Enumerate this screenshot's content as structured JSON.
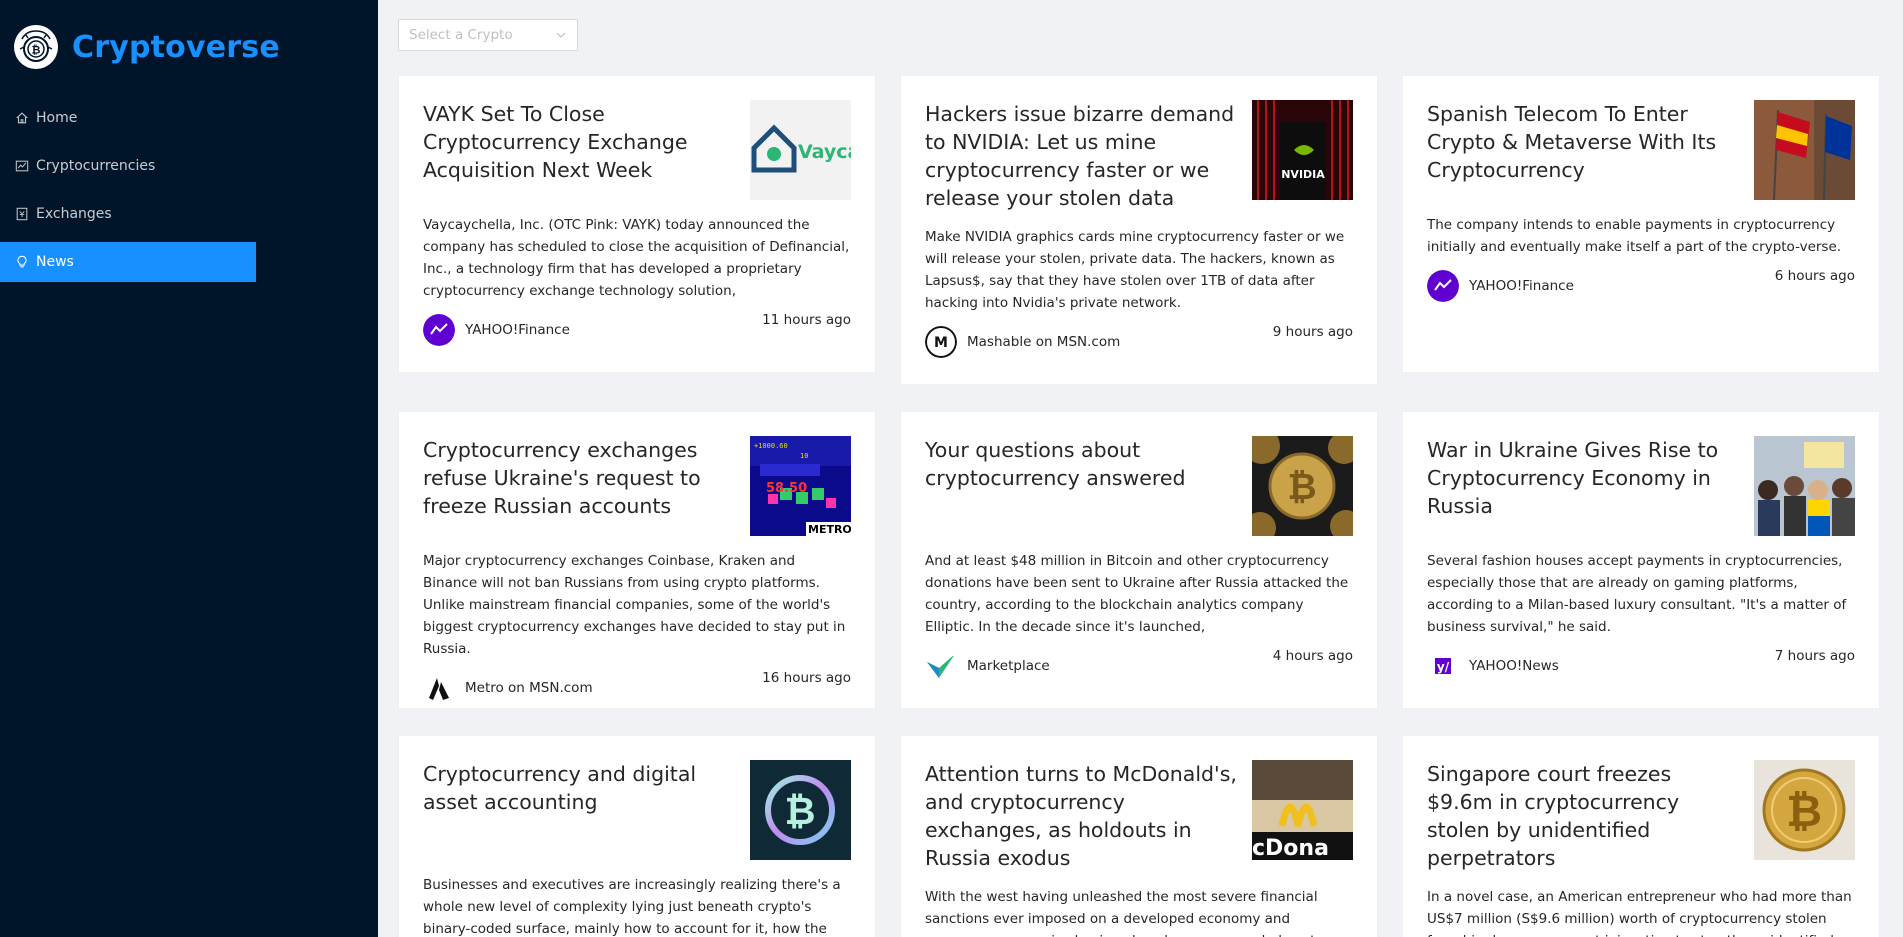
{
  "app": {
    "title": "Cryptoverse",
    "brand_color": "#1890ff",
    "sidebar_bg": "#001529"
  },
  "menu": [
    {
      "label": "Home",
      "icon": "home-icon"
    },
    {
      "label": "Cryptocurrencies",
      "icon": "fund-icon"
    },
    {
      "label": "Exchanges",
      "icon": "money-collect-icon"
    },
    {
      "label": "News",
      "icon": "bulb-icon",
      "active": true
    }
  ],
  "select": {
    "placeholder": "Select a Crypto"
  },
  "news": [
    {
      "title": "VAYK Set To Close Cryptocurrency Exchange Acquisition Next Week",
      "description": "Vaycaychella, Inc. (OTC Pink: VAYK) today announced the company has scheduled to close the acquisition of Definancial, Inc., a technology firm that has developed a proprietary cryptocurrency exchange technology solution,",
      "provider": "YAHOO!Finance",
      "time": "11 hours ago",
      "thumb_text": "Vayca"
    },
    {
      "title": "Hackers issue bizarre demand to NVIDIA: Let us mine cryptocurrency faster or we release your stolen data",
      "description": "Make NVIDIA graphics cards mine cryptocurrency faster or we will release your stolen, private data. The hackers, known as Lapsus$, say that they have stolen over 1TB of data after hacking into Nvidia's private network.",
      "provider": "Mashable on MSN.com",
      "time": "9 hours ago",
      "thumb_text": "NVIDIA"
    },
    {
      "title": "Spanish Telecom To Enter Crypto & Metaverse With Its Cryptocurrency",
      "description": "The company intends to enable payments in cryptocurrency initially and eventually make itself a part of the crypto-verse.",
      "provider": "YAHOO!Finance",
      "time": "6 hours ago"
    },
    {
      "title": "Cryptocurrency exchanges refuse Ukraine's request to freeze Russian accounts",
      "description": "Major cryptocurrency exchanges Coinbase, Kraken and Binance will not ban Russians from using crypto platforms. Unlike mainstream financial companies, some of the world's biggest cryptocurrency exchanges have decided to stay put in Russia.",
      "provider": "Metro on MSN.com",
      "time": "16 hours ago",
      "thumb_text": "METRO.c"
    },
    {
      "title": "Your questions about cryptocurrency answered",
      "description": "And at least $48 million in Bitcoin and other cryptocurrency donations have been sent to Ukraine after Russia attacked the country, according to the blockchain analytics company Elliptic. In the decade since it's launched,",
      "provider": "Marketplace",
      "time": "4 hours ago"
    },
    {
      "title": "War in Ukraine Gives Rise to Cryptocurrency Economy in Russia",
      "description": "Several fashion houses accept payments in cryptocurrencies, especially those that are already on gaming platforms, according to a Milan-based luxury consultant. \"It's a matter of business survival,\" he said.",
      "provider": "YAHOO!News",
      "time": "7 hours ago"
    },
    {
      "title": "Cryptocurrency and digital asset accounting",
      "description": "Businesses and executives are increasingly realizing there's a whole new level of complexity lying just beneath crypto's binary-coded surface, mainly how to account for it, how the accounting standards",
      "provider": "",
      "time": ""
    },
    {
      "title": "Attention turns to McDonald's, and cryptocurrency exchanges, as holdouts in Russia exodus",
      "description": "With the west having unleashed the most severe financial sanctions ever imposed on a developed economy and numerous companies having closed or announced plans to exit their operations in Russia,",
      "provider": "",
      "time": "",
      "thumb_text": "cDona"
    },
    {
      "title": "Singapore court freezes $9.6m in cryptocurrency stolen by unidentified perpetrators",
      "description": "In a novel case, an American entrepreneur who had more than US$7 million (S$9.6 million) worth of cryptocurrency stolen from him has won a court injunction to stop the unidentified perpetrators from",
      "provider": "",
      "time": ""
    }
  ]
}
